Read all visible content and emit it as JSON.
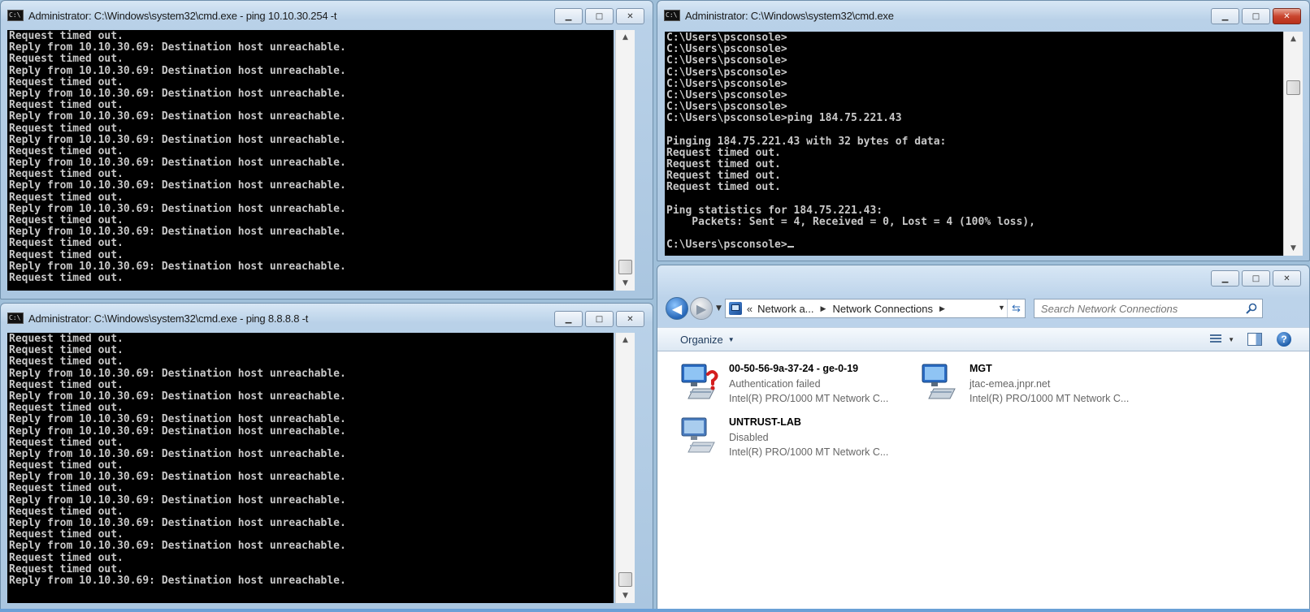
{
  "windows": {
    "cmd1": {
      "title": "Administrator: C:\\Windows\\system32\\cmd.exe - ping  10.10.30.254 -t",
      "lines": [
        "Request timed out.",
        "Reply from 10.10.30.69: Destination host unreachable.",
        "Request timed out.",
        "Reply from 10.10.30.69: Destination host unreachable.",
        "Request timed out.",
        "Reply from 10.10.30.69: Destination host unreachable.",
        "Request timed out.",
        "Reply from 10.10.30.69: Destination host unreachable.",
        "Request timed out.",
        "Reply from 10.10.30.69: Destination host unreachable.",
        "Request timed out.",
        "Reply from 10.10.30.69: Destination host unreachable.",
        "Request timed out.",
        "Reply from 10.10.30.69: Destination host unreachable.",
        "Request timed out.",
        "Reply from 10.10.30.69: Destination host unreachable.",
        "Request timed out.",
        "Reply from 10.10.30.69: Destination host unreachable.",
        "Request timed out.",
        "Request timed out.",
        "Reply from 10.10.30.69: Destination host unreachable.",
        "Request timed out."
      ]
    },
    "cmd2": {
      "title": "Administrator: C:\\Windows\\system32\\cmd.exe - ping  8.8.8.8 -t",
      "lines": [
        "Request timed out.",
        "Request timed out.",
        "Request timed out.",
        "Reply from 10.10.30.69: Destination host unreachable.",
        "Request timed out.",
        "Reply from 10.10.30.69: Destination host unreachable.",
        "Request timed out.",
        "Reply from 10.10.30.69: Destination host unreachable.",
        "Reply from 10.10.30.69: Destination host unreachable.",
        "Request timed out.",
        "Reply from 10.10.30.69: Destination host unreachable.",
        "Request timed out.",
        "Reply from 10.10.30.69: Destination host unreachable.",
        "Request timed out.",
        "Reply from 10.10.30.69: Destination host unreachable.",
        "Request timed out.",
        "Reply from 10.10.30.69: Destination host unreachable.",
        "Request timed out.",
        "Reply from 10.10.30.69: Destination host unreachable.",
        "Request timed out.",
        "Request timed out.",
        "Reply from 10.10.30.69: Destination host unreachable."
      ]
    },
    "cmd3": {
      "title": "Administrator: C:\\Windows\\system32\\cmd.exe",
      "lines": [
        "C:\\Users\\psconsole>",
        "C:\\Users\\psconsole>",
        "C:\\Users\\psconsole>",
        "C:\\Users\\psconsole>",
        "C:\\Users\\psconsole>",
        "C:\\Users\\psconsole>",
        "C:\\Users\\psconsole>",
        "C:\\Users\\psconsole>ping 184.75.221.43",
        "",
        "Pinging 184.75.221.43 with 32 bytes of data:",
        "Request timed out.",
        "Request timed out.",
        "Request timed out.",
        "Request timed out.",
        "",
        "Ping statistics for 184.75.221.43:",
        "    Packets: Sent = 4, Received = 0, Lost = 4 (100% loss),",
        "",
        "C:\\Users\\psconsole>"
      ]
    }
  },
  "explorer": {
    "breadcrumb": {
      "root_chevron": "«",
      "crumb1": "Network a...",
      "crumb2": "Network Connections"
    },
    "search_placeholder": "Search Network Connections",
    "toolbar": {
      "organize_label": "Organize"
    },
    "connections": [
      {
        "name": "00-50-56-9a-37-24 - ge-0-19",
        "status": "Authentication failed",
        "adapter": "Intel(R) PRO/1000 MT Network C...",
        "icon": "network-adapter-error-icon"
      },
      {
        "name": "MGT",
        "status": "jtac-emea.jnpr.net",
        "adapter": "Intel(R) PRO/1000 MT Network C...",
        "icon": "network-adapter-icon"
      },
      {
        "name": "UNTRUST-LAB",
        "status": "Disabled",
        "adapter": "Intel(R) PRO/1000 MT Network C...",
        "icon": "network-adapter-disabled-icon"
      }
    ]
  },
  "colors": {
    "console_bg": "#000000",
    "console_text": "#c8c8c8",
    "titlebar": "#b9d1e8",
    "close_red": "#c9452e",
    "error_badge": "#d41e1e"
  }
}
